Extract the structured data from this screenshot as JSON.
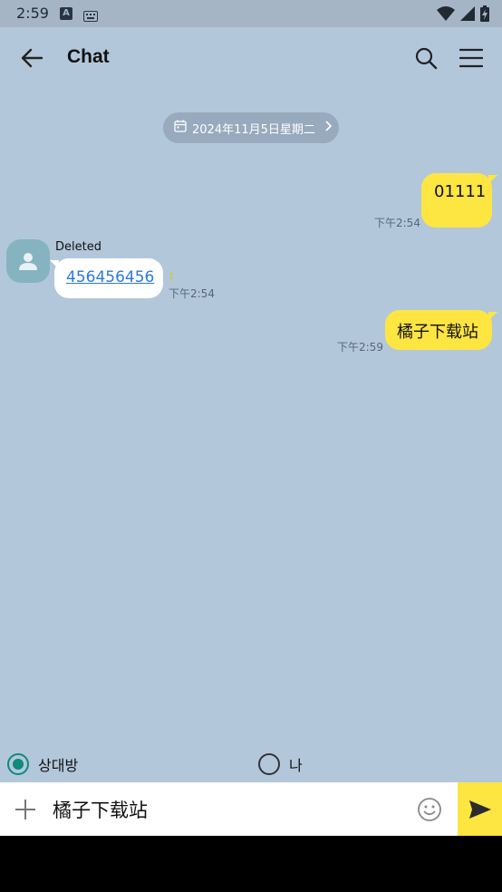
{
  "status_bar": {
    "time": "2:59",
    "icons": [
      "a-badge-icon",
      "keyboard-icon",
      "wifi-icon",
      "signal-icon",
      "battery-charging-icon"
    ]
  },
  "app_bar": {
    "title": "Chat",
    "icons": [
      "back-arrow-icon",
      "search-icon",
      "menu-icon"
    ]
  },
  "date_divider": {
    "label": "2024年11月5日星期二",
    "icons": [
      "calendar-icon",
      "chevron-right-icon"
    ]
  },
  "messages": [
    {
      "direction": "outgoing",
      "text": "01111",
      "time": "下午2:54"
    },
    {
      "direction": "incoming",
      "sender": "Deleted",
      "text": "456456456",
      "unread": "1",
      "time": "下午2:54"
    },
    {
      "direction": "outgoing",
      "text": "橘子下载站",
      "time": "下午2:59"
    }
  ],
  "speaker_selector": {
    "options": [
      {
        "label": "상대방",
        "selected": true
      },
      {
        "label": "나",
        "selected": false
      }
    ]
  },
  "composer": {
    "value": "橘子下载站",
    "icons": [
      "plus-icon",
      "emoji-icon",
      "send-icon"
    ]
  },
  "colors": {
    "chat_background": "#b3c7db",
    "outgoing_bubble": "#fde542",
    "incoming_bubble": "#ffffff",
    "radio_accent": "#0f8a7c",
    "link": "#2a7bd8"
  }
}
